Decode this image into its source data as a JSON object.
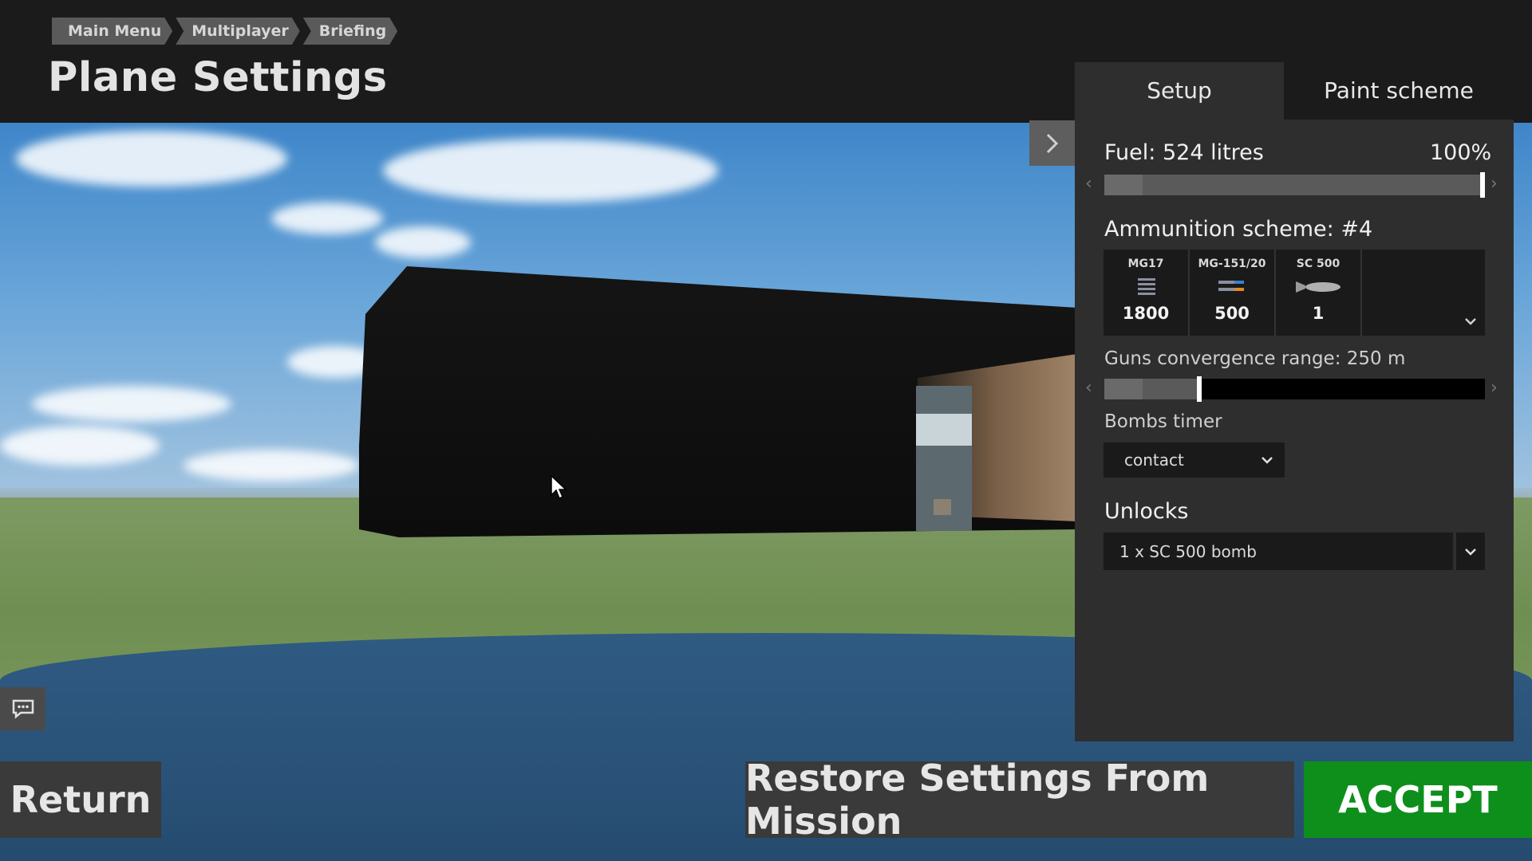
{
  "breadcrumb": [
    {
      "label": "Main Menu"
    },
    {
      "label": "Multiplayer"
    },
    {
      "label": "Briefing"
    }
  ],
  "page_title": "Plane Settings",
  "tabs": [
    {
      "label": "Setup",
      "active": true
    },
    {
      "label": "Paint scheme",
      "active": false
    }
  ],
  "fuel": {
    "label": "Fuel: 524 litres",
    "percent_label": "100%",
    "level": 1.0
  },
  "ammunition": {
    "label": "Ammunition scheme: #4",
    "items": [
      {
        "name": "MG17",
        "count": "1800",
        "icon": "bullets-icon"
      },
      {
        "name": "MG-151/20",
        "count": "500",
        "icon": "shells-icon"
      },
      {
        "name": "SC 500",
        "count": "1",
        "icon": "bomb-icon"
      }
    ]
  },
  "convergence": {
    "label": "Guns convergence range: 250 m",
    "level": 0.25
  },
  "bombs_timer": {
    "label": "Bombs timer",
    "value": "contact"
  },
  "unlocks": {
    "label": "Unlocks",
    "value": "1 x SC 500 bomb"
  },
  "buttons": {
    "return": "Return",
    "restore": "Restore Settings From Mission",
    "accept": "ACCEPT"
  },
  "colors": {
    "accept": "#0e8f1b",
    "panel": "#2e2e2e"
  }
}
